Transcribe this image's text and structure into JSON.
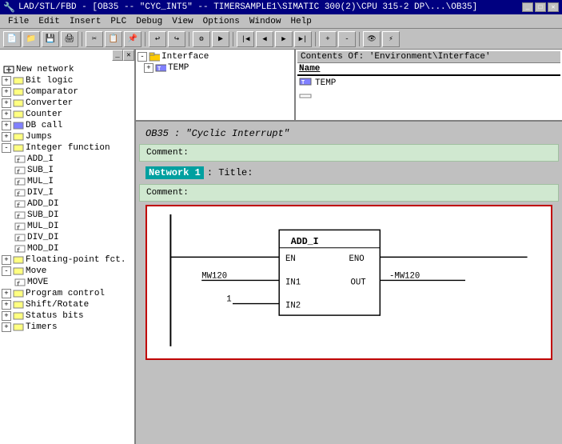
{
  "titlebar": {
    "title": "LAD/STL/FBD  - [OB35 -- \"CYC_INT5\" -- TIMERSAMPLE1\\SIMATIC 300(2)\\CPU 315-2 DP\\...\\OB35]"
  },
  "menubar": {
    "items": [
      "File",
      "Edit",
      "Insert",
      "PLC",
      "Debug",
      "View",
      "Options",
      "Window",
      "Help"
    ]
  },
  "toolbar": {
    "buttons": [
      "📁",
      "💾",
      "🖨️",
      "✂️",
      "📋",
      "📌",
      "↩",
      "↪",
      "⚙",
      "▶",
      "⏹",
      "◀",
      "▶",
      "⏭",
      "⏮",
      "⏭"
    ]
  },
  "left_panel": {
    "items": [
      {
        "label": "New network",
        "level": 0,
        "expandable": false,
        "icon": "network"
      },
      {
        "label": "Bit logic",
        "level": 0,
        "expandable": true,
        "expanded": false,
        "icon": "folder"
      },
      {
        "label": "Comparator",
        "level": 0,
        "expandable": true,
        "expanded": false,
        "icon": "folder"
      },
      {
        "label": "Converter",
        "level": 0,
        "expandable": true,
        "expanded": false,
        "icon": "folder"
      },
      {
        "label": "Counter",
        "level": 0,
        "expandable": true,
        "expanded": false,
        "icon": "folder"
      },
      {
        "label": "DB call",
        "level": 0,
        "expandable": true,
        "expanded": false,
        "icon": "folder"
      },
      {
        "label": "Jumps",
        "level": 0,
        "expandable": true,
        "expanded": false,
        "icon": "folder"
      },
      {
        "label": "Integer function",
        "level": 0,
        "expandable": true,
        "expanded": true,
        "icon": "folder"
      },
      {
        "label": "ADD_I",
        "level": 1,
        "expandable": false,
        "icon": "item"
      },
      {
        "label": "SUB_I",
        "level": 1,
        "expandable": false,
        "icon": "item"
      },
      {
        "label": "MUL_I",
        "level": 1,
        "expandable": false,
        "icon": "item"
      },
      {
        "label": "DIV_I",
        "level": 1,
        "expandable": false,
        "icon": "item"
      },
      {
        "label": "ADD_DI",
        "level": 1,
        "expandable": false,
        "icon": "item"
      },
      {
        "label": "SUB_DI",
        "level": 1,
        "expandable": false,
        "icon": "item"
      },
      {
        "label": "MUL_DI",
        "level": 1,
        "expandable": false,
        "icon": "item"
      },
      {
        "label": "DIV_DI",
        "level": 1,
        "expandable": false,
        "icon": "item"
      },
      {
        "label": "MOD_DI",
        "level": 1,
        "expandable": false,
        "icon": "item"
      },
      {
        "label": "Floating-point fct.",
        "level": 0,
        "expandable": true,
        "expanded": false,
        "icon": "folder"
      },
      {
        "label": "Move",
        "level": 0,
        "expandable": true,
        "expanded": true,
        "icon": "folder"
      },
      {
        "label": "MOVE",
        "level": 1,
        "expandable": false,
        "icon": "item"
      },
      {
        "label": "Program control",
        "level": 0,
        "expandable": true,
        "expanded": false,
        "icon": "folder"
      },
      {
        "label": "Shift/Rotate",
        "level": 0,
        "expandable": true,
        "expanded": false,
        "icon": "folder"
      },
      {
        "label": "Status bits",
        "level": 0,
        "expandable": true,
        "expanded": false,
        "icon": "folder"
      },
      {
        "label": "Timers",
        "level": 0,
        "expandable": true,
        "expanded": false,
        "icon": "folder"
      }
    ]
  },
  "interface_section": {
    "header": "Contents Of: 'Environment\\Interface'",
    "tree": {
      "items": [
        {
          "label": "Interface",
          "level": 0,
          "expanded": true
        },
        {
          "label": "TEMP",
          "level": 1
        }
      ]
    },
    "contents": {
      "column_header": "Name",
      "rows": [
        {
          "icon": "db-icon",
          "name": "TEMP"
        }
      ],
      "empty_row": true
    }
  },
  "code_editor": {
    "ob_title": "OB35 :  \"Cyclic Interrupt\"",
    "comment_label": "Comment:",
    "network1": {
      "label": "Network 1",
      "title": ": Title:",
      "comment_label": "Comment:",
      "diagram": {
        "block_name": "ADD_I",
        "en": "EN",
        "eno": "ENO",
        "in1": "IN1",
        "in2": "IN2",
        "out": "OUT",
        "in1_wire": "MW120",
        "in2_wire": "1",
        "out_wire": "MW120"
      }
    }
  }
}
